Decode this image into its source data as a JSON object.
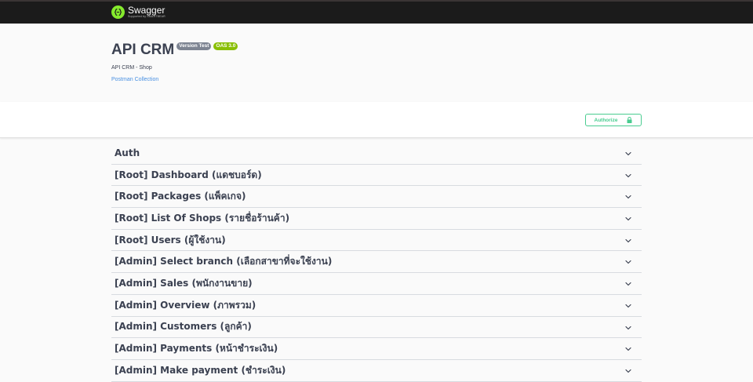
{
  "topbar": {
    "brand_name": "Swagger",
    "brand_sub": "Supported by SMARTBEAR",
    "logo_icon": "swagger-logo-icon"
  },
  "info": {
    "title": "API CRM",
    "version_badge": "Version Test",
    "oas_badge": "OAS 3.0",
    "description": "API CRM - Shop",
    "postman_link": "Postman Collection"
  },
  "scheme": {
    "authorize_label": "Authorize",
    "lock_icon": "lock-icon"
  },
  "colors": {
    "topbar": "#1b1b1b",
    "brand_green": "#85ea2d",
    "version_badge": "#7d8492",
    "oas_badge": "#89bf04",
    "authorize": "#49cc90",
    "link": "#4990e2",
    "text": "#3b4151"
  },
  "tags": [
    {
      "label": "Auth"
    },
    {
      "label": "[Root] Dashboard (แดชบอร์ด)"
    },
    {
      "label": "[Root] Packages (แพ็คเกจ)"
    },
    {
      "label": "[Root] List Of Shops (รายชื่อร้านค้า)"
    },
    {
      "label": "[Root] Users (ผู้ใช้งาน)"
    },
    {
      "label": "[Admin] Select branch (เลือกสาขาที่จะใช้งาน)"
    },
    {
      "label": "[Admin] Sales (พนักงานขาย)"
    },
    {
      "label": "[Admin] Overview (ภาพรวม)"
    },
    {
      "label": "[Admin] Customers (ลูกค้า)"
    },
    {
      "label": "[Admin] Payments (หน้าชำระเงิน)"
    },
    {
      "label": "[Admin] Make payment (ชำระเงิน)"
    }
  ]
}
